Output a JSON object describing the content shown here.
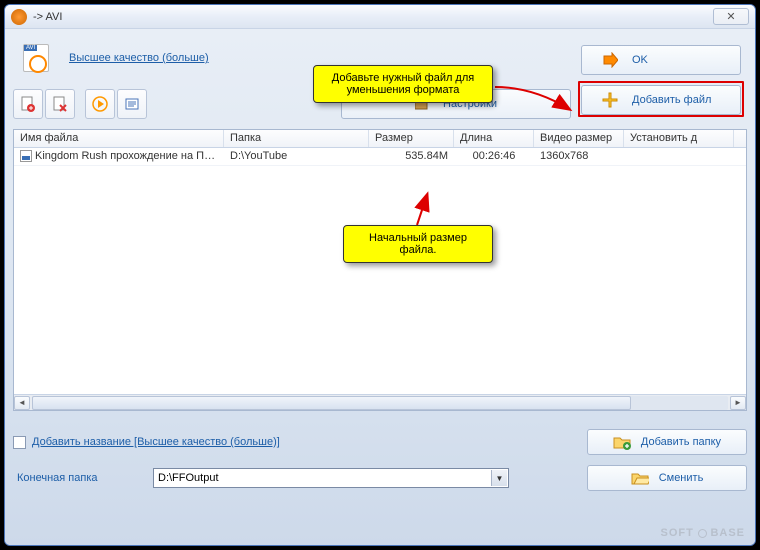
{
  "titlebar": {
    "title": " -> AVI",
    "close": "✕"
  },
  "top": {
    "quality_link": "Высшее качество (больше)"
  },
  "toolbar": {
    "settings_label": "Настройки"
  },
  "buttons": {
    "ok": "OK",
    "add_file": "Добавить файл",
    "add_folder": "Добавить папку",
    "change": "Сменить"
  },
  "table": {
    "headers": {
      "filename": "Имя файла",
      "folder": "Папка",
      "size": "Размер",
      "length": "Длина",
      "video_size": "Видео размер",
      "set": "Установить д"
    },
    "rows": [
      {
        "filename": "Kingdom Rush прохождение на ПК ...",
        "folder": "D:\\YouTube",
        "size": "535.84M",
        "length": "00:26:46",
        "video_size": "1360x768",
        "set": ""
      }
    ]
  },
  "bottom": {
    "add_title": "Добавить название [Высшее качество (больше)]",
    "output_label": "Конечная папка",
    "output_path": "D:\\FFOutput"
  },
  "callouts": {
    "add_file": "Добавьте нужный файл для уменьшения формата",
    "size": "Начальный размер файла."
  },
  "watermark": {
    "left": "SOFT",
    "right": "BASE"
  }
}
